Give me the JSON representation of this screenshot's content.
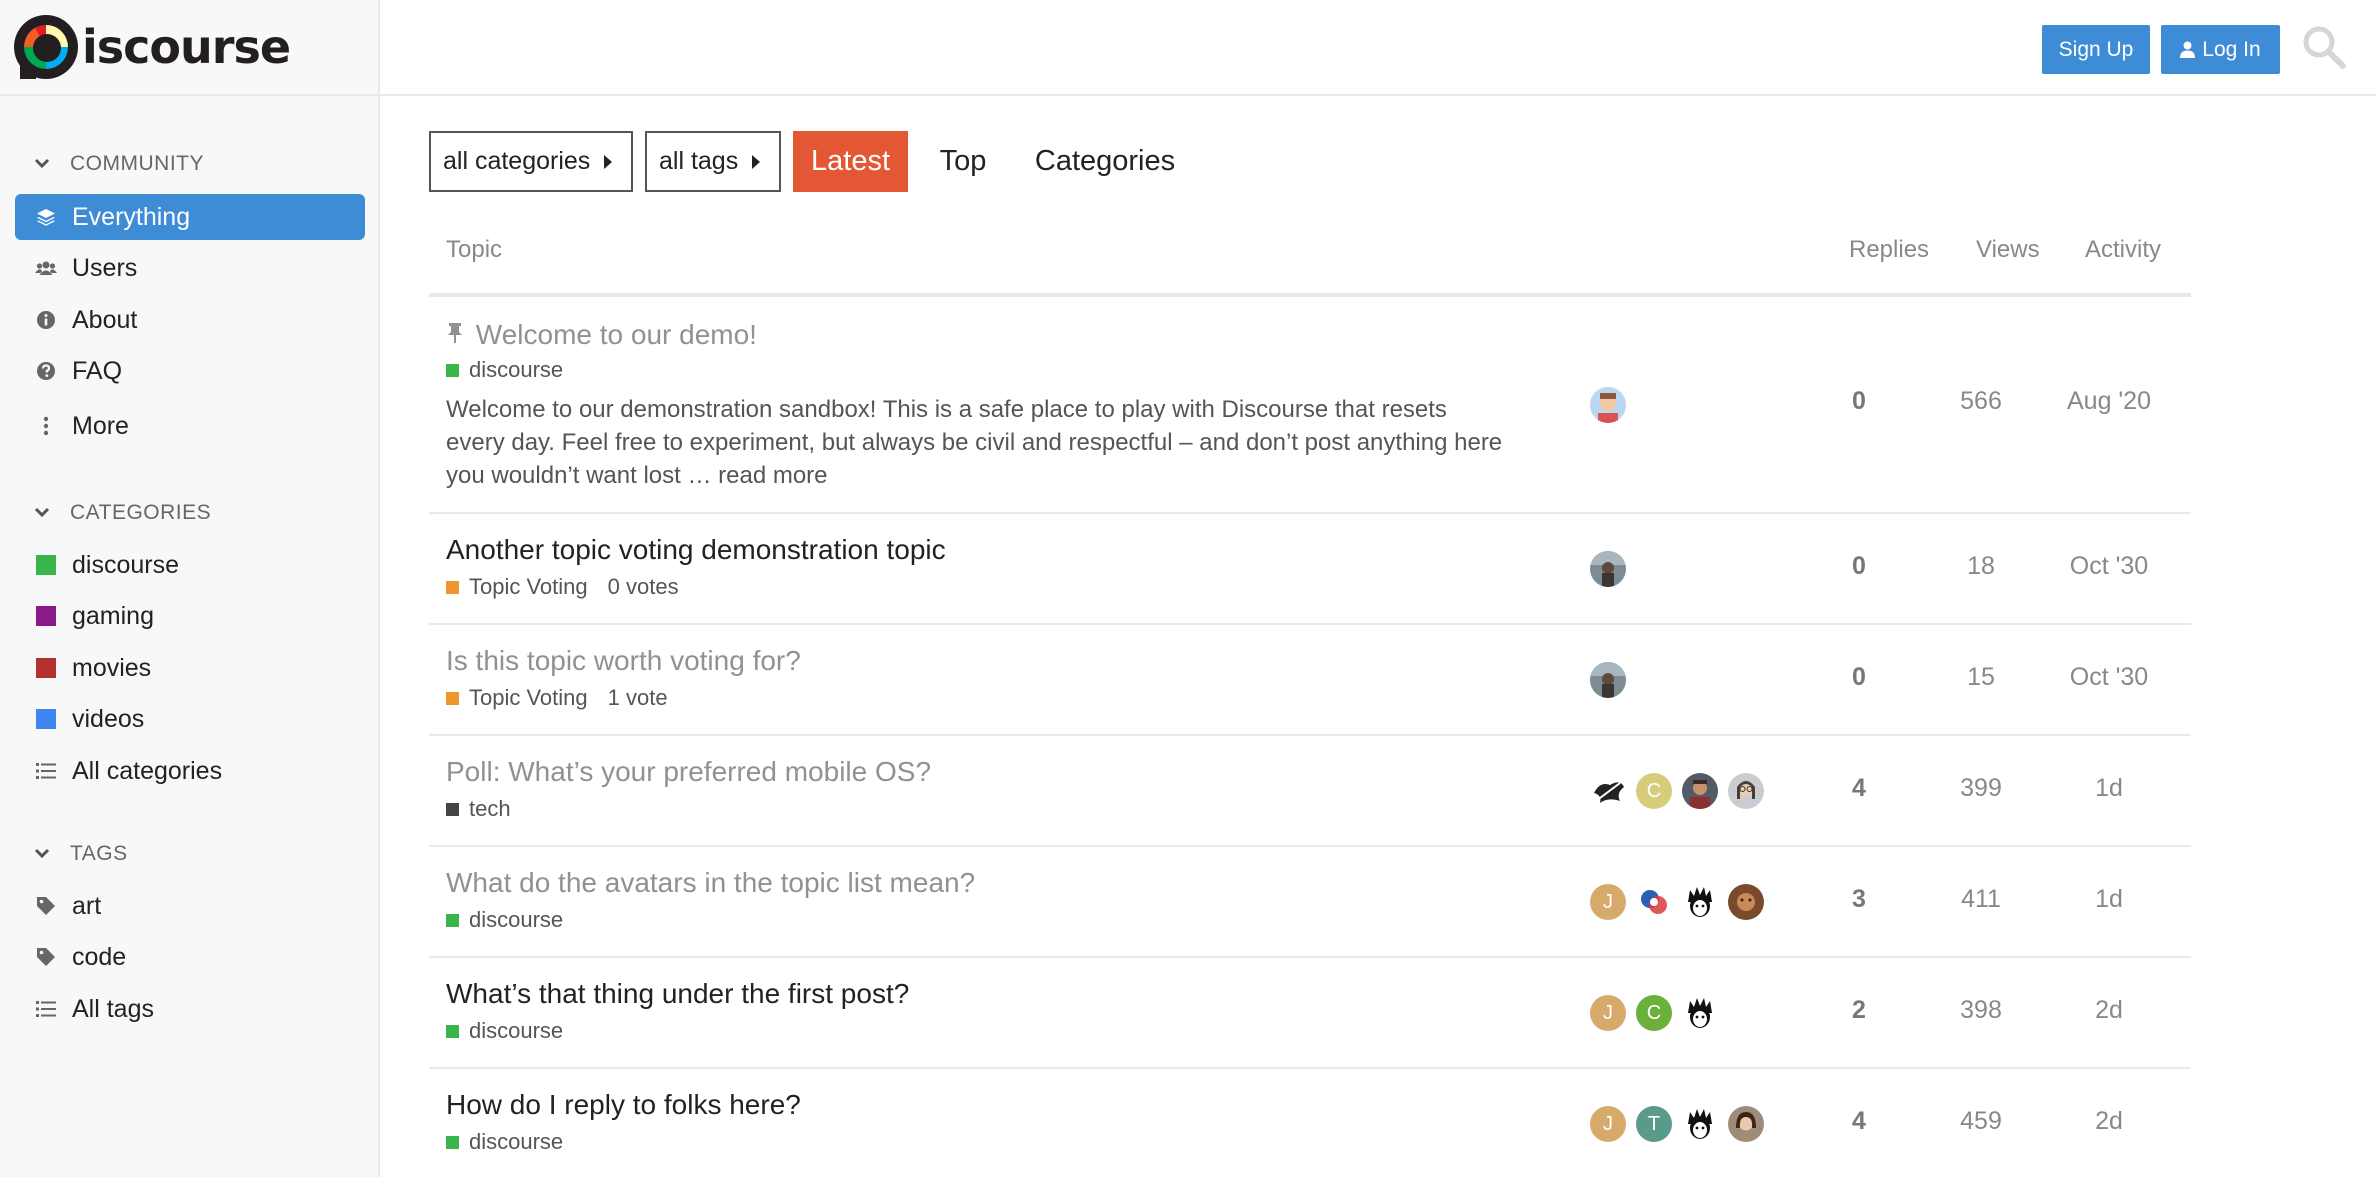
{
  "logo": {
    "text": "iscourse"
  },
  "header": {
    "signup_label": "Sign Up",
    "login_label": "Log In"
  },
  "sidebar": {
    "community_heading": "COMMUNITY",
    "community_items": [
      {
        "label": "Everything",
        "icon": "layers-icon"
      },
      {
        "label": "Users",
        "icon": "users-icon"
      },
      {
        "label": "About",
        "icon": "info-icon"
      },
      {
        "label": "FAQ",
        "icon": "question-icon"
      },
      {
        "label": "More",
        "icon": "ellipsis-icon"
      }
    ],
    "categories_heading": "CATEGORIES",
    "categories": [
      {
        "label": "discourse",
        "color": "#3ab54a"
      },
      {
        "label": "gaming",
        "color": "#8b1b8b"
      },
      {
        "label": "movies",
        "color": "#b3312f"
      },
      {
        "label": "videos",
        "color": "#3d86f0"
      }
    ],
    "all_categories_label": "All categories",
    "tags_heading": "TAGS",
    "tags": [
      {
        "label": "art"
      },
      {
        "label": "code"
      }
    ],
    "all_tags_label": "All tags"
  },
  "filters": {
    "categories_label": "all categories",
    "tags_label": "all tags",
    "tabs": [
      {
        "label": "Latest"
      },
      {
        "label": "Top"
      },
      {
        "label": "Categories"
      }
    ]
  },
  "table": {
    "headers": {
      "topic": "Topic",
      "replies": "Replies",
      "views": "Views",
      "activity": "Activity"
    },
    "rows": [
      {
        "title": "Welcome to our demo!",
        "pinned": true,
        "read": true,
        "category": "discourse",
        "category_color": "#3ab54a",
        "votes": "",
        "excerpt": "Welcome to our demonstration sandbox! This is a safe place to play with Discourse that resets every day. Feel free to experiment, but always be civil and respectful – and don’t post anything here you wouldn’t want lost … read more",
        "replies": "0",
        "views": "566",
        "activity": "Aug '20"
      },
      {
        "title": "Another topic voting demonstration topic",
        "read": false,
        "category": "Topic Voting",
        "category_color": "#f1962c",
        "votes": "0 votes",
        "replies": "0",
        "views": "18",
        "activity": "Oct '30"
      },
      {
        "title": "Is this topic worth voting for?",
        "read": true,
        "category": "Topic Voting",
        "category_color": "#f1962c",
        "votes": "1 vote",
        "replies": "0",
        "views": "15",
        "activity": "Oct '30"
      },
      {
        "title": "Poll: What’s your preferred mobile OS?",
        "read": true,
        "category": "tech",
        "category_color": "#444444",
        "votes": "",
        "replies": "4",
        "views": "399",
        "activity": "1d"
      },
      {
        "title": "What do the avatars in the topic list mean?",
        "read": true,
        "category": "discourse",
        "category_color": "#3ab54a",
        "votes": "",
        "replies": "3",
        "views": "411",
        "activity": "1d"
      },
      {
        "title": "What’s that thing under the first post?",
        "read": false,
        "category": "discourse",
        "category_color": "#3ab54a",
        "votes": "",
        "replies": "2",
        "views": "398",
        "activity": "2d"
      },
      {
        "title": "How do I reply to folks here?",
        "read": false,
        "category": "discourse",
        "category_color": "#3ab54a",
        "votes": "",
        "replies": "4",
        "views": "459",
        "activity": "2d"
      }
    ],
    "avatar_letters": {
      "c": "C",
      "j": "J",
      "t": "T"
    }
  },
  "colors": {
    "primary_blue": "#3e8bd6",
    "latest_orange": "#e45735"
  }
}
